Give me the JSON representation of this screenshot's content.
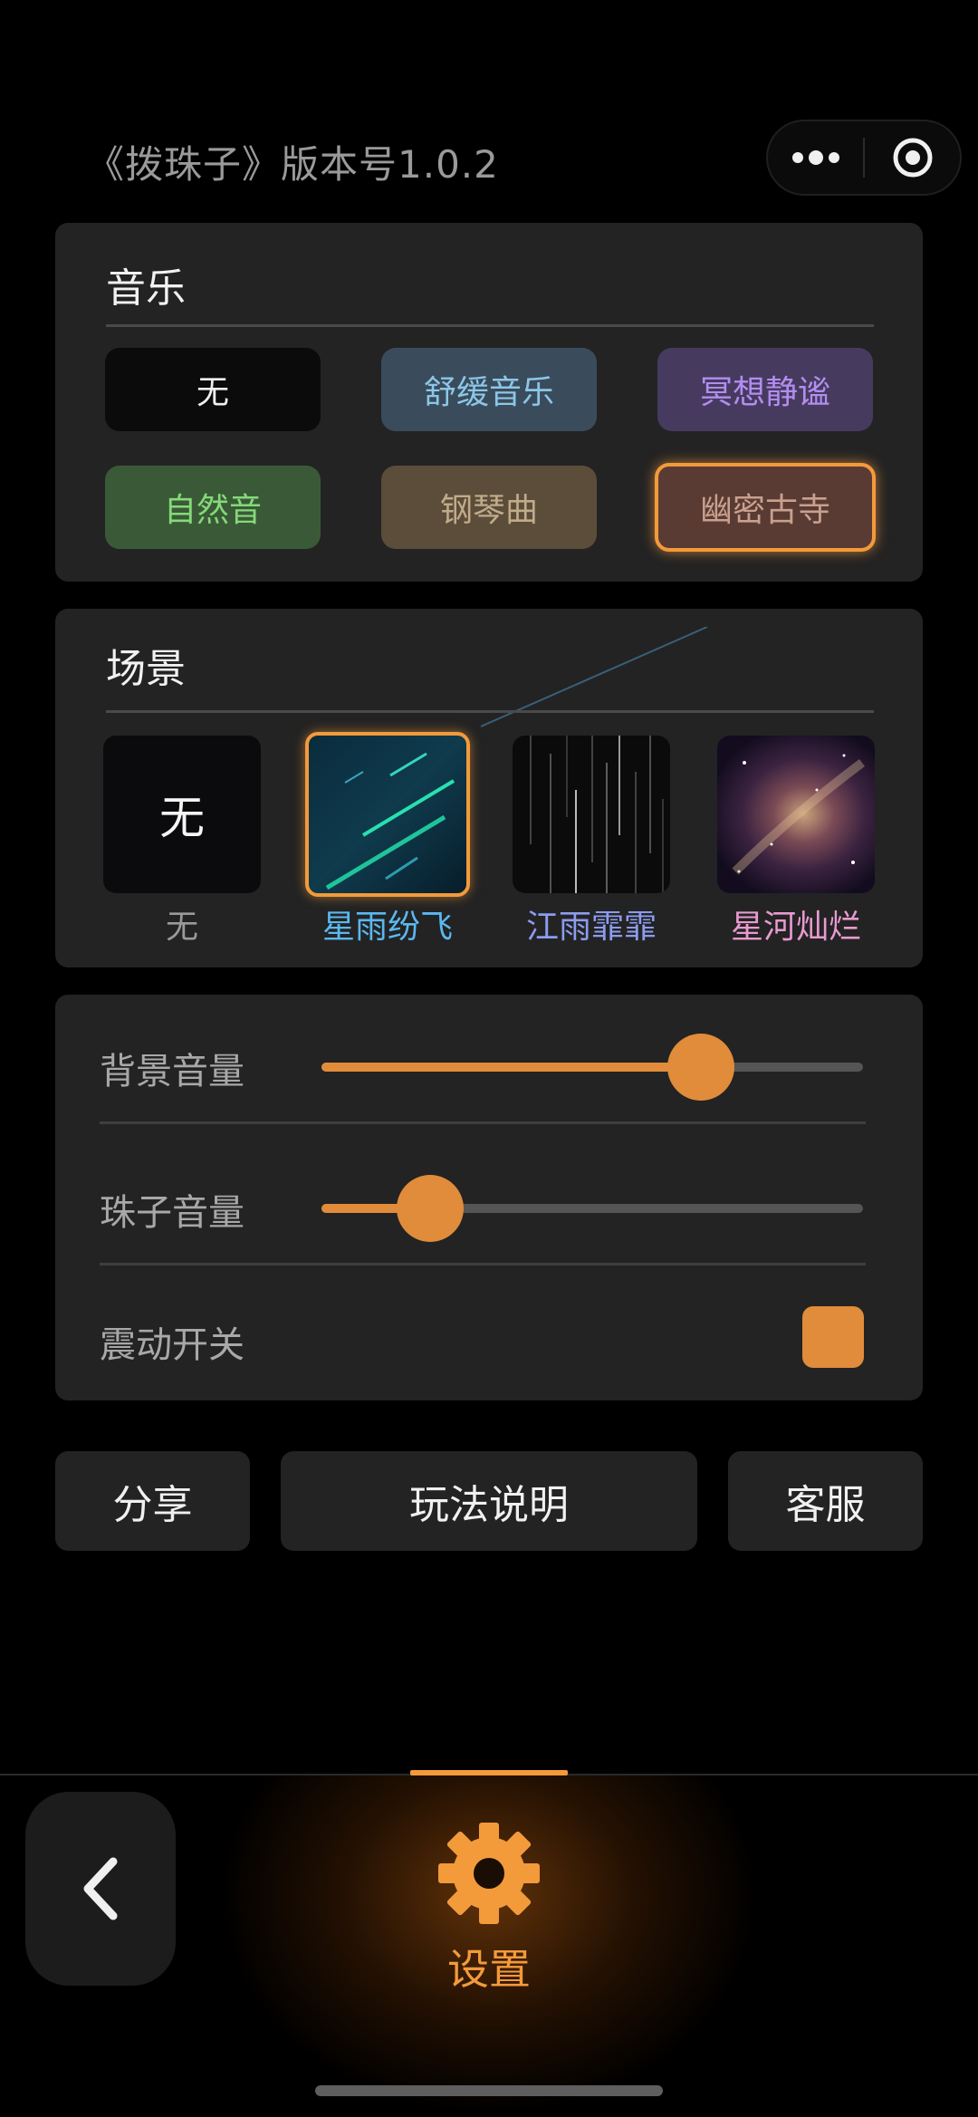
{
  "header": {
    "title": "《拨珠子》版本号1.0.2",
    "more_icon": "more-dots-icon",
    "close_icon": "target-circle-icon"
  },
  "music": {
    "title": "音乐",
    "options": [
      {
        "label": "无",
        "color": "#f0f0f0",
        "bg": "#0b0b0b"
      },
      {
        "label": "舒缓音乐",
        "color": "#8cc6e8",
        "bg": "#3a4c5b"
      },
      {
        "label": "冥想静谧",
        "color": "#b38df0",
        "bg": "#463b5f"
      },
      {
        "label": "自然音",
        "color": "#86d97a",
        "bg": "#3a5a37"
      },
      {
        "label": "钢琴曲",
        "color": "#c2ab8a",
        "bg": "#5b4d3a"
      },
      {
        "label": "幽密古寺",
        "color": "#c8a08f",
        "bg": "#5a3b33",
        "selected": true
      }
    ]
  },
  "scene": {
    "title": "场景",
    "options": [
      {
        "label": "无",
        "tile_text": "无",
        "color": "#9a9a9a"
      },
      {
        "label": "星雨纷飞",
        "color": "#5ab8f0",
        "selected": true
      },
      {
        "label": "江雨霏霏",
        "color": "#8c9cf0"
      },
      {
        "label": "星河灿烂",
        "color": "#e89ad0"
      }
    ]
  },
  "controls": {
    "bg_volume": {
      "label": "背景音量",
      "value": 0.7
    },
    "bead_volume": {
      "label": "珠子音量",
      "value": 0.2
    },
    "vibration": {
      "label": "震动开关",
      "on": true
    }
  },
  "actions": {
    "share": "分享",
    "howto": "玩法说明",
    "service": "客服"
  },
  "tabbar": {
    "back_icon": "chevron-left-icon",
    "settings_icon": "gear-icon",
    "settings_label": "设置"
  },
  "colors": {
    "accent": "#e08c3a",
    "tab_accent": "#f39a3b"
  }
}
